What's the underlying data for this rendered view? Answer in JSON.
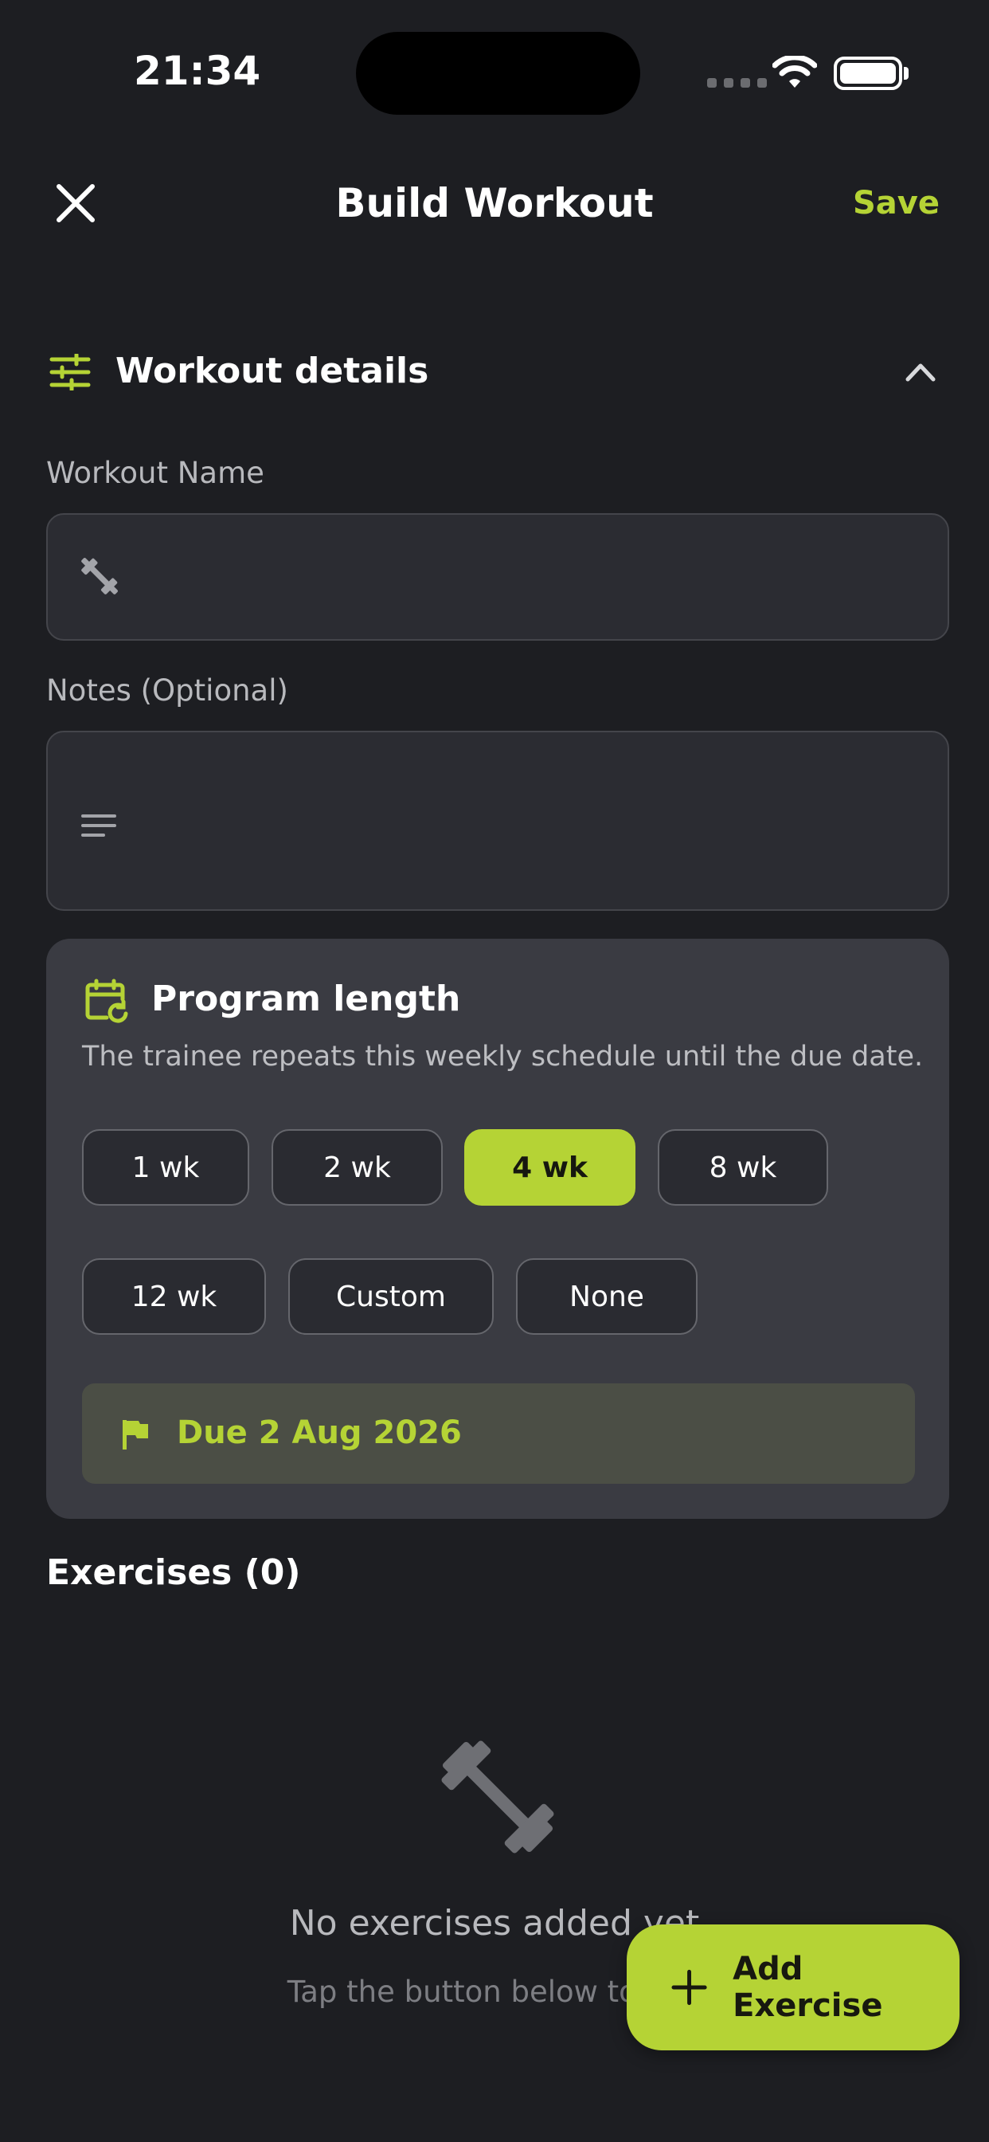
{
  "status_bar": {
    "time": "21:34"
  },
  "header": {
    "title": "Build Workout",
    "save_label": "Save"
  },
  "details": {
    "section_title": "Workout details",
    "name_label": "Workout Name",
    "name_value": "",
    "notes_label": "Notes (Optional)",
    "notes_value": ""
  },
  "program": {
    "title": "Program length",
    "description": "The trainee repeats this weekly schedule until the due date.",
    "options": [
      "1 wk",
      "2 wk",
      "4 wk",
      "8 wk",
      "12 wk",
      "Custom",
      "None"
    ],
    "selected": "4 wk",
    "due_text": "Due 2 Aug 2026"
  },
  "exercises": {
    "title": "Exercises (0)",
    "empty_title": "No exercises added yet",
    "empty_subtitle": "Tap the button below to add"
  },
  "fab": {
    "label": "Add Exercise"
  },
  "colors": {
    "accent": "#b5d335",
    "background": "#1d1e22",
    "card": "#3a3b42"
  }
}
